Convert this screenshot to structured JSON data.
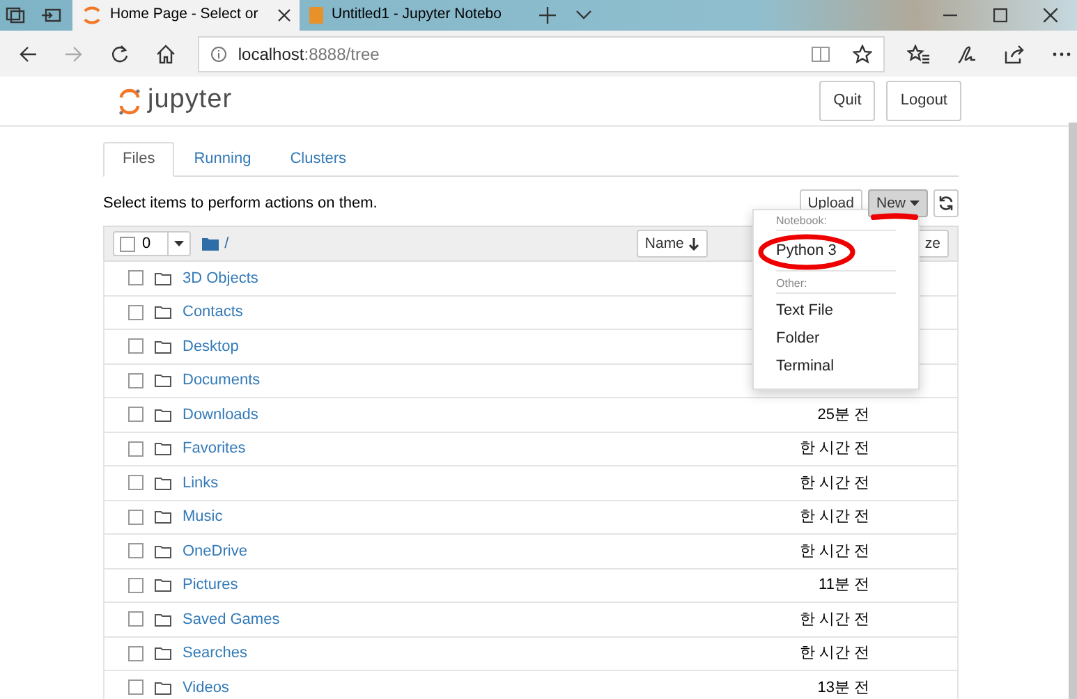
{
  "browser": {
    "tabs": [
      {
        "title": "Home Page - Select or",
        "selected": true
      },
      {
        "title": "Untitled1 - Jupyter Notebo",
        "selected": false
      }
    ],
    "address": {
      "host": "localhost",
      "path": ":8888/tree"
    }
  },
  "header": {
    "logo": "jupyter",
    "buttons": [
      "Quit",
      "Logout"
    ]
  },
  "tabs": [
    {
      "label": "Files",
      "selected": true
    },
    {
      "label": "Running",
      "selected": false
    },
    {
      "label": "Clusters",
      "selected": false
    }
  ],
  "toolbar": {
    "hint": "Select items to perform actions on them.",
    "buttons": [
      {
        "label": "Upload",
        "kind": "button"
      },
      {
        "label": "New",
        "kind": "dropdown",
        "expanded": true
      },
      {
        "kind": "refresh"
      }
    ]
  },
  "listing": {
    "selected_count": "0",
    "path": "/",
    "columns": [
      "Name",
      "ze"
    ],
    "rows": [
      {
        "name": "3D Objects",
        "checked": false
      },
      {
        "name": "Contacts",
        "checked": false
      },
      {
        "name": "Desktop",
        "checked": false
      },
      {
        "name": "Documents",
        "checked": false
      },
      {
        "name": "Downloads",
        "modified": "25분 전",
        "checked": false
      },
      {
        "name": "Favorites",
        "modified": "한 시간 전",
        "checked": false
      },
      {
        "name": "Links",
        "modified": "한 시간 전",
        "checked": false
      },
      {
        "name": "Music",
        "modified": "한 시간 전",
        "checked": false
      },
      {
        "name": "OneDrive",
        "modified": "한 시간 전",
        "checked": false
      },
      {
        "name": "Pictures",
        "modified": "11분 전",
        "checked": false
      },
      {
        "name": "Saved Games",
        "modified": "한 시간 전",
        "checked": false
      },
      {
        "name": "Searches",
        "modified": "한 시간 전",
        "checked": false
      },
      {
        "name": "Videos",
        "modified": "13분 전",
        "checked": false
      }
    ]
  },
  "menu": {
    "sections": [
      {
        "heading": "Notebook:",
        "items": [
          {
            "label": "Python 3",
            "circled": true
          }
        ]
      },
      {
        "heading": "Other:",
        "items": [
          {
            "label": "Text File",
            "circled": false
          },
          {
            "label": "Folder",
            "circled": false
          },
          {
            "label": "Terminal",
            "circled": false
          }
        ]
      }
    ]
  }
}
